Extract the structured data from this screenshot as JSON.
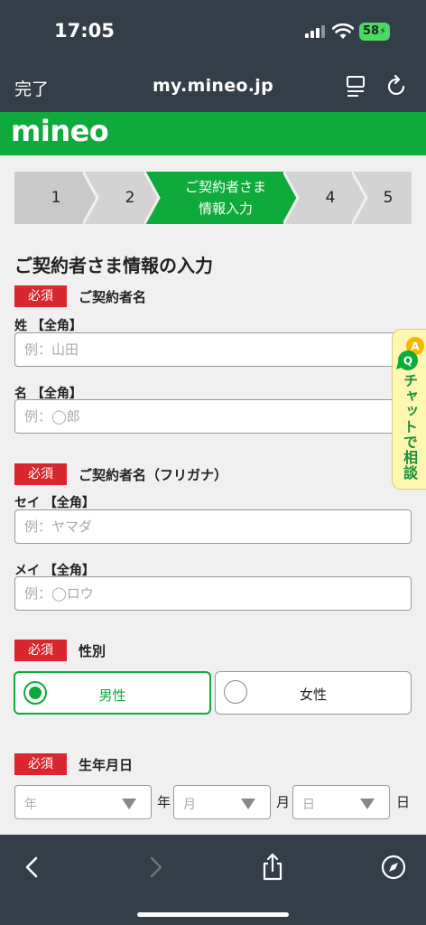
{
  "status": {
    "time": "17:05",
    "battery": "58"
  },
  "browser": {
    "done": "完了",
    "url": "my.mineo.jp"
  },
  "brand": {
    "logo": "mineo"
  },
  "steps": [
    {
      "label": "1"
    },
    {
      "label": "2"
    },
    {
      "label_line1": "ご契約者さま",
      "label_line2": "情報入力",
      "active": true
    },
    {
      "label": "4"
    },
    {
      "label": "5"
    }
  ],
  "form": {
    "title": "ご契約者さま情報の入力",
    "required_badge": "必須",
    "name_section": {
      "label": "ご契約者名",
      "last_label": "姓 【全角】",
      "last_placeholder": "例：山田",
      "first_label": "名 【全角】",
      "first_placeholder": "例：◯郎"
    },
    "kana_section": {
      "label": "ご契約者名（フリガナ）",
      "last_label": "セイ 【全角】",
      "last_placeholder": "例：ヤマダ",
      "first_label": "メイ 【全角】",
      "first_placeholder": "例：◯ロウ"
    },
    "gender": {
      "label": "性別",
      "options": [
        "男性",
        "女性"
      ],
      "selected": "男性"
    },
    "birthdate": {
      "label": "生年月日",
      "year_placeholder": "年",
      "month_placeholder": "月",
      "day_placeholder": "日",
      "year_unit": "年",
      "month_unit": "月",
      "day_unit": "日"
    }
  },
  "chat": {
    "label": "チャットで相談",
    "badge_a": "A",
    "badge_q": "Q"
  },
  "colors": {
    "brand_green": "#0eaa3c",
    "required_red": "#d9262f",
    "chrome_dark": "#343e49"
  }
}
